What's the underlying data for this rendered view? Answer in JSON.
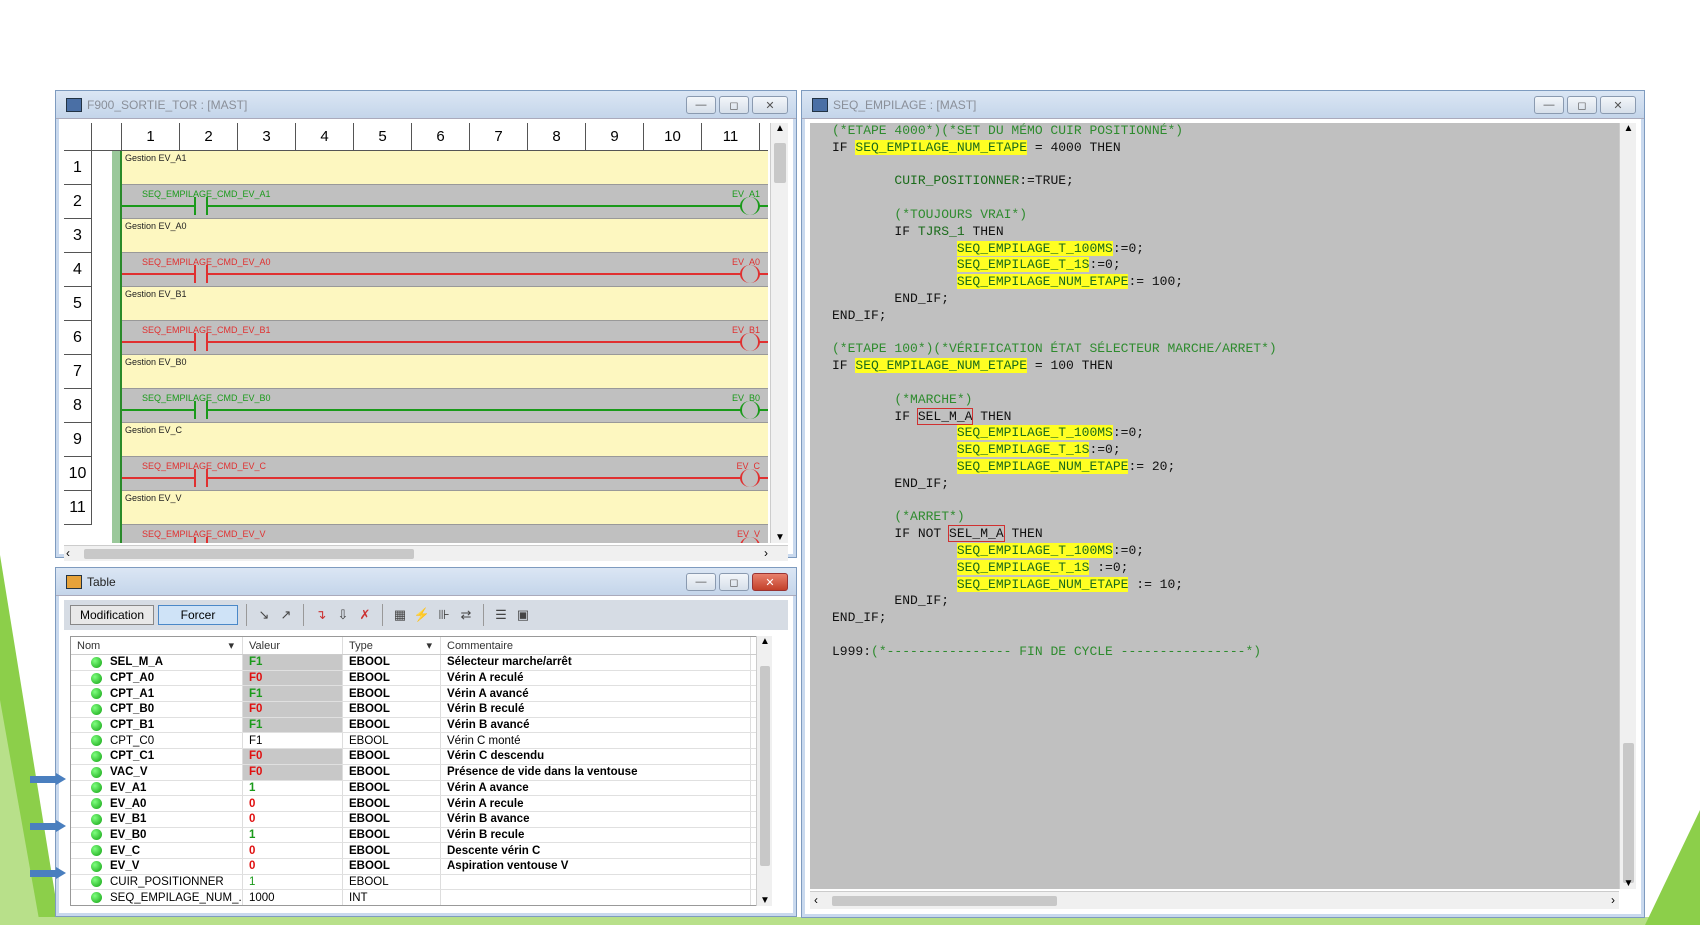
{
  "ladder_window": {
    "title": "F900_SORTIE_TOR : [MAST]",
    "columns": [
      "1",
      "2",
      "3",
      "4",
      "5",
      "6",
      "7",
      "8",
      "9",
      "10",
      "11"
    ],
    "rows": [
      "1",
      "2",
      "3",
      "4",
      "5",
      "6",
      "7",
      "8",
      "9",
      "10",
      "11"
    ],
    "rungs": [
      {
        "comment": "Gestion EV_A1",
        "contact": "SEQ_EMPILAGE_CMD_EV_A1",
        "coil": "EV_A1",
        "state": "on"
      },
      {
        "comment": "Gestion EV_A0",
        "contact": "SEQ_EMPILAGE_CMD_EV_A0",
        "coil": "EV_A0",
        "state": "off"
      },
      {
        "comment": "Gestion EV_B1",
        "contact": "SEQ_EMPILAGE_CMD_EV_B1",
        "coil": "EV_B1",
        "state": "off"
      },
      {
        "comment": "Gestion EV_B0",
        "contact": "SEQ_EMPILAGE_CMD_EV_B0",
        "coil": "EV_B0",
        "state": "on"
      },
      {
        "comment": "Gestion EV_C",
        "contact": "SEQ_EMPILAGE_CMD_EV_C",
        "coil": "EV_C",
        "state": "off"
      },
      {
        "comment": "Gestion EV_V",
        "contact": "SEQ_EMPILAGE_CMD_EV_V",
        "coil": "EV_V",
        "state": "off"
      }
    ]
  },
  "code_window": {
    "title": "SEQ_EMPILAGE : [MAST]"
  },
  "table_window": {
    "title": "Table",
    "btn_modification": "Modification",
    "btn_forcer": "Forcer",
    "headers": {
      "nom": "Nom",
      "valeur": "Valeur",
      "type": "Type",
      "commentaire": "Commentaire"
    },
    "rows": [
      {
        "nom": "SEL_M_A",
        "valeur": "F1",
        "type": "EBOOL",
        "commentaire": "Sélecteur marche/arrêt",
        "vcolor": "grn",
        "forced": true,
        "bold": true
      },
      {
        "nom": "CPT_A0",
        "valeur": "F0",
        "type": "EBOOL",
        "commentaire": "Vérin A reculé",
        "vcolor": "red",
        "forced": true,
        "bold": true
      },
      {
        "nom": "CPT_A1",
        "valeur": "F1",
        "type": "EBOOL",
        "commentaire": "Vérin A avancé",
        "vcolor": "grn",
        "forced": true,
        "bold": true
      },
      {
        "nom": "CPT_B0",
        "valeur": "F0",
        "type": "EBOOL",
        "commentaire": "Vérin B reculé",
        "vcolor": "red",
        "forced": true,
        "bold": true
      },
      {
        "nom": "CPT_B1",
        "valeur": "F1",
        "type": "EBOOL",
        "commentaire": "Vérin B avancé",
        "vcolor": "grn",
        "forced": true,
        "bold": true
      },
      {
        "nom": "CPT_C0",
        "valeur": "F1",
        "type": "EBOOL",
        "commentaire": "Vérin C monté",
        "vcolor": "",
        "forced": false,
        "bold": false
      },
      {
        "nom": "CPT_C1",
        "valeur": "F0",
        "type": "EBOOL",
        "commentaire": "Vérin C descendu",
        "vcolor": "red",
        "forced": true,
        "bold": true
      },
      {
        "nom": "VAC_V",
        "valeur": "F0",
        "type": "EBOOL",
        "commentaire": "Présence de vide dans la ventouse",
        "vcolor": "red",
        "forced": true,
        "bold": true
      },
      {
        "nom": "EV_A1",
        "valeur": "1",
        "type": "EBOOL",
        "commentaire": "Vérin A avance",
        "vcolor": "grn",
        "forced": false,
        "bold": true
      },
      {
        "nom": "EV_A0",
        "valeur": "0",
        "type": "EBOOL",
        "commentaire": "Vérin A recule",
        "vcolor": "red",
        "forced": false,
        "bold": true
      },
      {
        "nom": "EV_B1",
        "valeur": "0",
        "type": "EBOOL",
        "commentaire": "Vérin B avance",
        "vcolor": "red",
        "forced": false,
        "bold": true
      },
      {
        "nom": "EV_B0",
        "valeur": "1",
        "type": "EBOOL",
        "commentaire": "Vérin B recule",
        "vcolor": "grn",
        "forced": false,
        "bold": true
      },
      {
        "nom": "EV_C",
        "valeur": "0",
        "type": "EBOOL",
        "commentaire": "Descente vérin C",
        "vcolor": "red",
        "forced": false,
        "bold": true
      },
      {
        "nom": "EV_V",
        "valeur": "0",
        "type": "EBOOL",
        "commentaire": "Aspiration ventouse V",
        "vcolor": "red",
        "forced": false,
        "bold": true
      },
      {
        "nom": "CUIR_POSITIONNER",
        "valeur": "1",
        "type": "EBOOL",
        "commentaire": "",
        "vcolor": "grn",
        "forced": false,
        "bold": false
      },
      {
        "nom": "SEQ_EMPILAGE_NUM_...",
        "valeur": "1000",
        "type": "INT",
        "commentaire": "",
        "vcolor": "",
        "forced": false,
        "bold": false
      }
    ]
  },
  "colors": {
    "forced_bg": "#c8c8c8",
    "highlight": "#ffff22",
    "accent": "#8ccf4a"
  }
}
